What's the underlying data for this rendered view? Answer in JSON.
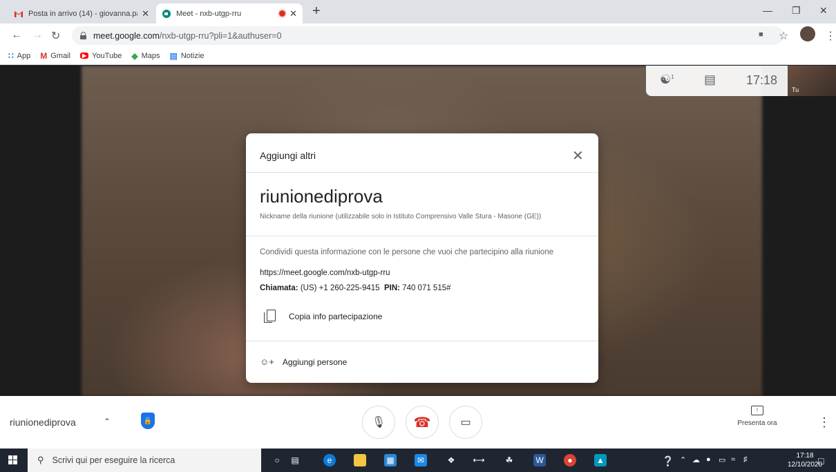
{
  "browser": {
    "tabs": [
      {
        "title": "Posta in arrivo (14) - giovanna.pa",
        "favicon": "gmail-icon",
        "close": "✕"
      },
      {
        "title": "Meet - nxb-utgp-rru",
        "favicon": "meet-icon",
        "close": "✕",
        "recording": true
      }
    ],
    "new_tab": "+",
    "url_host": "meet.google.com",
    "url_rest": "/nxb-utgp-rru?pli=1&authuser=0",
    "bookmarks": [
      {
        "label": "App",
        "icon": "apps-grid-icon"
      },
      {
        "label": "Gmail",
        "icon": "gmail-icon"
      },
      {
        "label": "YouTube",
        "icon": "youtube-icon"
      },
      {
        "label": "Maps",
        "icon": "maps-icon"
      },
      {
        "label": "Notizie",
        "icon": "news-icon"
      }
    ]
  },
  "meet": {
    "participants_badge": "1",
    "clock": "17:18",
    "self_label": "Tu",
    "dialog": {
      "title": "Aggiungi altri",
      "meeting_name": "riunionediprova",
      "nickname_note": "Nickname della riunione (utilizzabile solo in Istituto Comprensivo Valle Stura - Masone (GE))",
      "share_text": "Condividi questa informazione con le persone che vuoi che partecipino alla riunione",
      "link": "https://meet.google.com/nxb-utgp-rru",
      "call_label": "Chiamata:",
      "call_value": "(US) +1 260-225-9415",
      "pin_label": "PIN:",
      "pin_value": "740 071 515#",
      "copy_label": "Copia info partecipazione",
      "add_label": "Aggiungi persone"
    },
    "bottom": {
      "meeting_name": "riunionediprova",
      "present_label": "Presenta ora"
    }
  },
  "taskbar": {
    "search_placeholder": "Scrivi qui per eseguire la ricerca",
    "time": "17:18",
    "date": "12/10/2020"
  },
  "colors": {
    "accent_blue": "#1a73e8",
    "hangup_red": "#d93025",
    "taskbar": "#1f2631"
  }
}
